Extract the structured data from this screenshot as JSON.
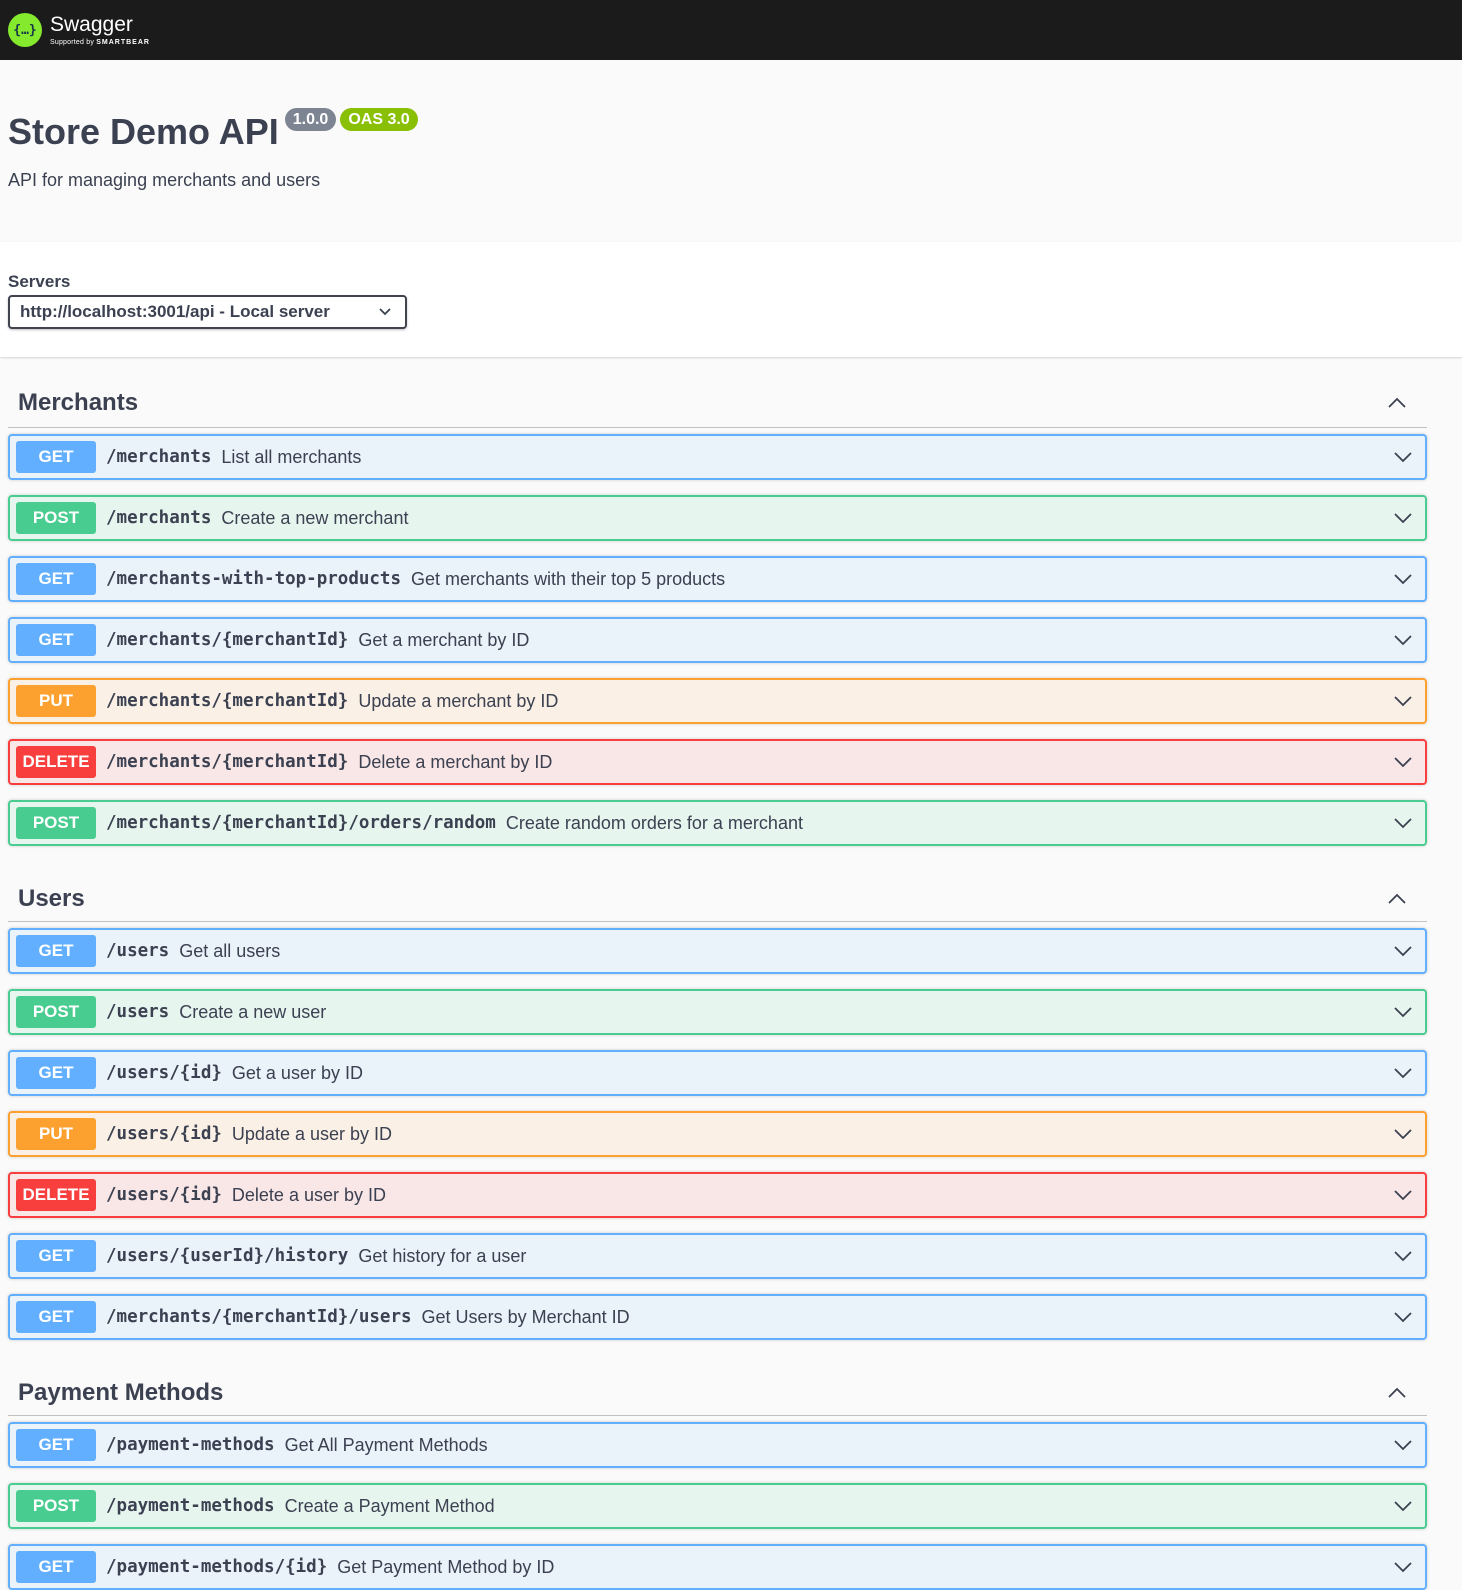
{
  "topbar": {
    "logo_glyph": "{…}",
    "logo_name": "Swagger",
    "logo_supported": "Supported by",
    "logo_company": "SMARTBEAR"
  },
  "info": {
    "title": "Store Demo API",
    "version": "1.0.0",
    "oas": "OAS 3.0",
    "description": "API for managing merchants and users"
  },
  "servers": {
    "label": "Servers",
    "selected": "http://localhost:3001/api - Local server"
  },
  "colors": {
    "get": "#61affe",
    "post": "#49cc90",
    "put": "#fca130",
    "delete": "#f93e3e"
  },
  "tags": [
    {
      "name": "Merchants",
      "operations": [
        {
          "method": "GET",
          "path": "/merchants",
          "summary": "List all merchants"
        },
        {
          "method": "POST",
          "path": "/merchants",
          "summary": "Create a new merchant"
        },
        {
          "method": "GET",
          "path": "/merchants-with-top-products",
          "summary": "Get merchants with their top 5 products"
        },
        {
          "method": "GET",
          "path": "/merchants/{merchantId}",
          "summary": "Get a merchant by ID"
        },
        {
          "method": "PUT",
          "path": "/merchants/{merchantId}",
          "summary": "Update a merchant by ID"
        },
        {
          "method": "DELETE",
          "path": "/merchants/{merchantId}",
          "summary": "Delete a merchant by ID"
        },
        {
          "method": "POST",
          "path": "/merchants/{merchantId}/orders/random",
          "summary": "Create random orders for a merchant"
        }
      ]
    },
    {
      "name": "Users",
      "operations": [
        {
          "method": "GET",
          "path": "/users",
          "summary": "Get all users"
        },
        {
          "method": "POST",
          "path": "/users",
          "summary": "Create a new user"
        },
        {
          "method": "GET",
          "path": "/users/{id}",
          "summary": "Get a user by ID"
        },
        {
          "method": "PUT",
          "path": "/users/{id}",
          "summary": "Update a user by ID"
        },
        {
          "method": "DELETE",
          "path": "/users/{id}",
          "summary": "Delete a user by ID"
        },
        {
          "method": "GET",
          "path": "/users/{userId}/history",
          "summary": "Get history for a user"
        },
        {
          "method": "GET",
          "path": "/merchants/{merchantId}/users",
          "summary": "Get Users by Merchant ID"
        }
      ]
    },
    {
      "name": "Payment Methods",
      "operations": [
        {
          "method": "GET",
          "path": "/payment-methods",
          "summary": "Get All Payment Methods"
        },
        {
          "method": "POST",
          "path": "/payment-methods",
          "summary": "Create a Payment Method"
        },
        {
          "method": "GET",
          "path": "/payment-methods/{id}",
          "summary": "Get Payment Method by ID"
        }
      ]
    }
  ]
}
